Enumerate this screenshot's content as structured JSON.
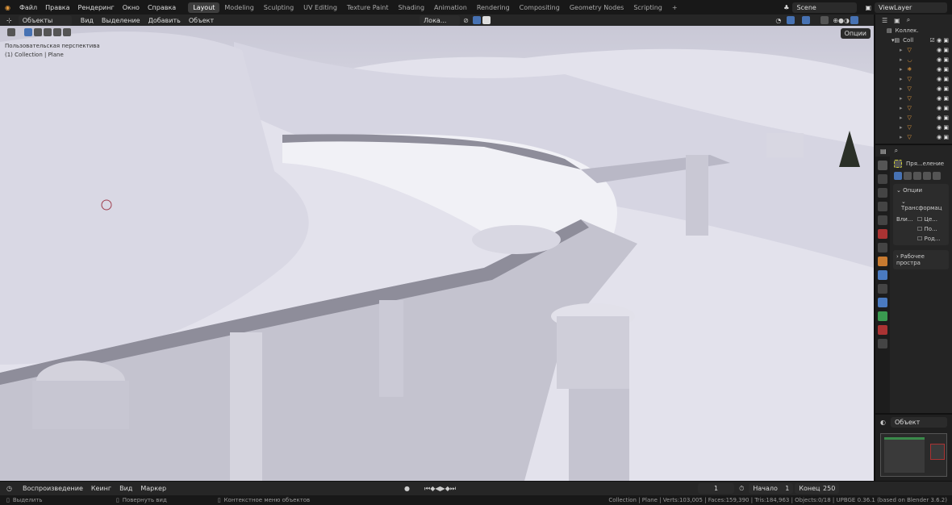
{
  "topbar": {
    "menus": [
      "Файл",
      "Правка",
      "Рендеринг",
      "Окно",
      "Справка"
    ],
    "workspaces": [
      "Layout",
      "Modeling",
      "Sculpting",
      "UV Editing",
      "Texture Paint",
      "Shading",
      "Animation",
      "Rendering",
      "Compositing",
      "Geometry Nodes",
      "Scripting",
      "+"
    ],
    "scene": "Scene",
    "view_layer": "ViewLayer"
  },
  "vp_header": {
    "mode": "Объекты",
    "menus": [
      "Вид",
      "Выделение",
      "Добавить",
      "Объект"
    ],
    "transform": "Лока...",
    "options": "Опции"
  },
  "viewport": {
    "perspective": "Пользовательская перспектива",
    "context": "(1) Collection | Plane"
  },
  "outliner": {
    "root": "Коллек.",
    "collection": "Coll"
  },
  "properties": {
    "tool": "Пря...еление",
    "options": "Опции",
    "transform": "Трансформац",
    "affect": "Вли...",
    "checks": [
      "Це...",
      "По...",
      "Род..."
    ],
    "workspace": "Рабочее простра"
  },
  "shader": {
    "mode": "Объект"
  },
  "timeline": {
    "menus": [
      "Воспроизведение",
      "Кеинг",
      "Вид",
      "Маркер"
    ],
    "frame": "1",
    "start_label": "Начало",
    "start": "1",
    "end_label": "Конец",
    "end": "250"
  },
  "status": {
    "hints": [
      "Выделить",
      "Повернуть вид",
      "Контекстное меню объектов"
    ],
    "info": "Collection | Plane | Verts:103,005 | Faces:159,390 | Tris:184,963 | Objects:0/18 | UPBGE 0.36.1 (based on Blender 3.6.2)"
  },
  "colors": {
    "accent": "#4772b3",
    "mesh": "#e69a3c"
  }
}
